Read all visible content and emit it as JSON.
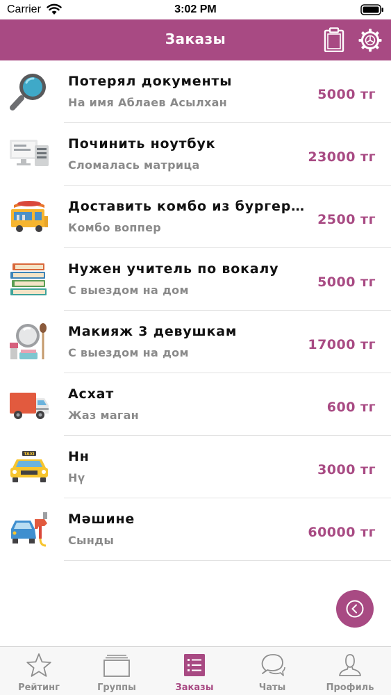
{
  "status_bar": {
    "carrier": "Carrier",
    "time": "3:02 PM"
  },
  "header": {
    "title": "Заказы",
    "actions": [
      "clipboard-icon",
      "gear-icon"
    ]
  },
  "orders": [
    {
      "title": "Потерял документы",
      "subtitle": "На имя Аблаев Асылхан",
      "price": "5000 тг",
      "icon": "magnifier-icon"
    },
    {
      "title": "Починить ноутбук",
      "subtitle": "Сломалась матрица",
      "price": "23000 тг",
      "icon": "computer-icon"
    },
    {
      "title": "Доставить комбо из бургер кинг",
      "subtitle": "Комбо воппер",
      "price": "2500 тг",
      "icon": "food-truck-icon"
    },
    {
      "title": "Нужен учитель по вокалу",
      "subtitle": "С выездом на дом",
      "price": "5000 тг",
      "icon": "books-icon"
    },
    {
      "title": "Макияж 3 девушкам",
      "subtitle": "С выездом на дом",
      "price": "17000 тг",
      "icon": "makeup-icon"
    },
    {
      "title": "Асхат",
      "subtitle": "Жаз маган",
      "price": "600 тг",
      "icon": "delivery-truck-icon"
    },
    {
      "title": "Нн",
      "subtitle": "Нү",
      "price": "3000 тг",
      "icon": "taxi-icon"
    },
    {
      "title": "Мәшине",
      "subtitle": "Сынды",
      "price": "60000 тг",
      "icon": "car-paint-icon"
    }
  ],
  "fab": {
    "icon": "chevron-left-icon"
  },
  "tabs": [
    {
      "label": "Рейтинг",
      "icon": "star-icon",
      "active": false
    },
    {
      "label": "Группы",
      "icon": "folder-icon",
      "active": false
    },
    {
      "label": "Заказы",
      "icon": "list-icon",
      "active": true
    },
    {
      "label": "Чаты",
      "icon": "chat-icon",
      "active": false
    },
    {
      "label": "Профиль",
      "icon": "profile-icon",
      "active": false
    }
  ],
  "colors": {
    "accent": "#a84a83",
    "subtitle": "#8a8a8a",
    "tab_inactive": "#8e8e8e"
  }
}
